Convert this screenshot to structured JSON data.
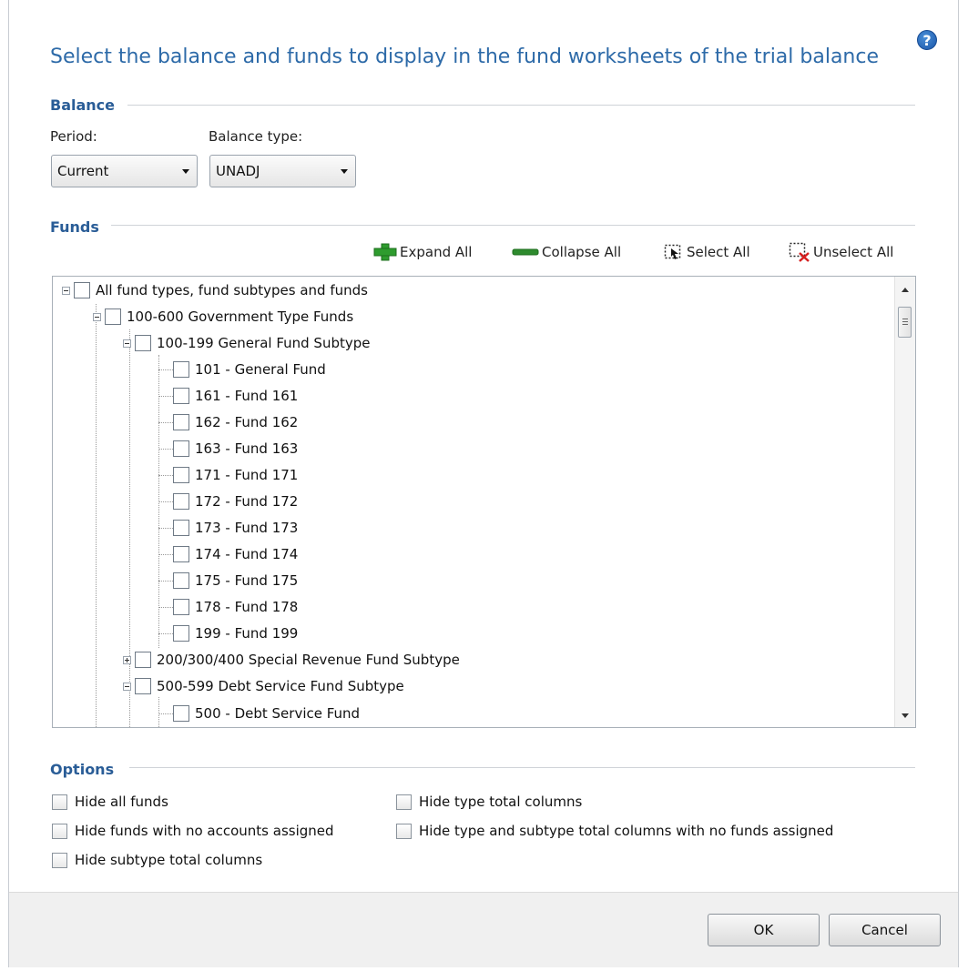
{
  "dialog": {
    "title": "Select the balance and funds to display in the fund worksheets of the trial balance",
    "help_icon": "question-icon",
    "help_glyph": "?"
  },
  "balance": {
    "header": "Balance",
    "period": {
      "label": "Period:",
      "value": "Current"
    },
    "balance_type": {
      "label": "Balance type:",
      "value": "UNADJ"
    }
  },
  "funds": {
    "header": "Funds",
    "toolbar": {
      "expand_all": "Expand All",
      "collapse_all": "Collapse All",
      "select_all": "Select All",
      "unselect_all": "Unselect All"
    },
    "tree": [
      {
        "label": "All fund types, fund subtypes and funds",
        "level": 0,
        "expander": "minus"
      },
      {
        "label": "100-600 Government Type Funds",
        "level": 1,
        "expander": "minus"
      },
      {
        "label": "100-199 General Fund Subtype",
        "level": 2,
        "expander": "minus"
      },
      {
        "label": "101 - General Fund",
        "level": 3,
        "expander": "none"
      },
      {
        "label": "161 - Fund 161",
        "level": 3,
        "expander": "none"
      },
      {
        "label": "162 - Fund 162",
        "level": 3,
        "expander": "none"
      },
      {
        "label": "163 - Fund 163",
        "level": 3,
        "expander": "none"
      },
      {
        "label": "171 - Fund 171",
        "level": 3,
        "expander": "none"
      },
      {
        "label": "172 - Fund 172",
        "level": 3,
        "expander": "none"
      },
      {
        "label": "173 - Fund 173",
        "level": 3,
        "expander": "none"
      },
      {
        "label": "174 - Fund 174",
        "level": 3,
        "expander": "none"
      },
      {
        "label": "175 - Fund 175",
        "level": 3,
        "expander": "none"
      },
      {
        "label": "178 - Fund 178",
        "level": 3,
        "expander": "none"
      },
      {
        "label": "199 - Fund 199",
        "level": 3,
        "expander": "none"
      },
      {
        "label": "200/300/400 Special Revenue Fund Subtype",
        "level": 2,
        "expander": "plus"
      },
      {
        "label": "500-599 Debt Service Fund Subtype",
        "level": 2,
        "expander": "minus"
      },
      {
        "label": "500 - Debt Service Fund",
        "level": 3,
        "expander": "none"
      }
    ]
  },
  "options": {
    "header": "Options",
    "hide_all_funds": "Hide all funds",
    "hide_funds_no_accounts": "Hide funds with no accounts assigned",
    "hide_subtype_totals": "Hide subtype total columns",
    "hide_type_totals": "Hide type total columns",
    "hide_type_subtype_no_funds": "Hide type and subtype total columns with no funds assigned"
  },
  "buttons": {
    "ok": "OK",
    "cancel": "Cancel"
  },
  "colors": {
    "title": "#2d6aa8",
    "section_header": "#2a5d97",
    "expand_icon": "#2e9c2e",
    "collapse_icon": "#2e8b2e",
    "unselect_x": "#d62020"
  }
}
